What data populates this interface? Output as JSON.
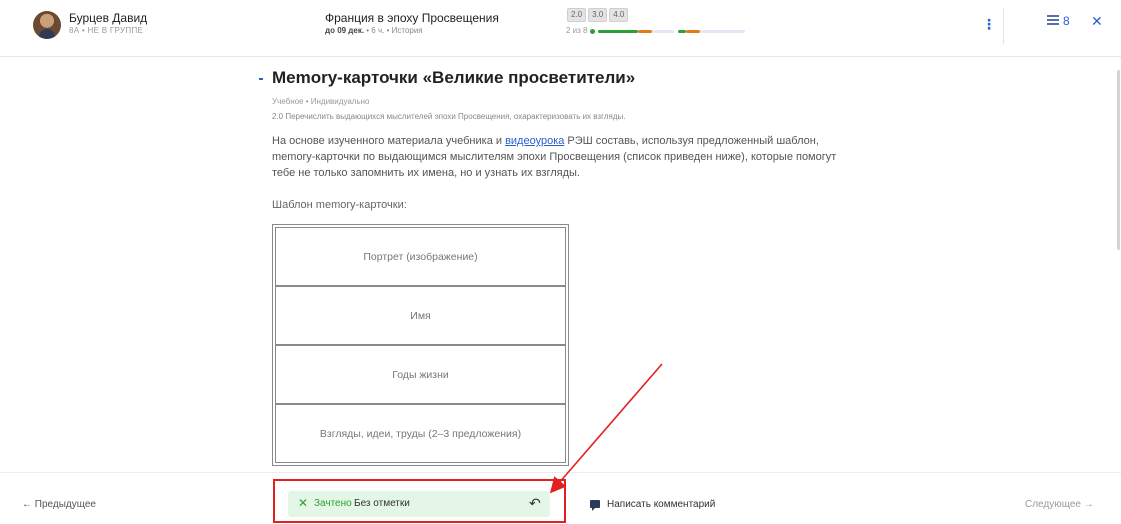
{
  "header": {
    "student_name": "Бурцев Давид",
    "student_group": "8А • НЕ В ГРУППЕ",
    "lesson_title": "Франция в эпоху Просвещения",
    "lesson_deadline": "до 09 дек.",
    "lesson_meta_rest": " • 6 ч. • История",
    "badges": [
      "2.0",
      "3.0",
      "4.0"
    ],
    "progress_text": "2 из 8",
    "progress_fraction": 0.25,
    "kebab_icon": "⋮",
    "tasks_count": "8",
    "close_icon": "✕"
  },
  "task": {
    "title": "Memory-карточки «Великие просветители»",
    "type": "Учебное • Индивидуально",
    "goal": "2.0 Перечислить выдающихся мыслителей эпохи Просвещения, охарактеризовать их взгляды.",
    "body_before_link": "На основе изученного материала учебника и ",
    "body_link": "видеоурока",
    "body_after_link": " РЭШ составь, используя предложенный шаблон, memory-карточки по выдающимся мыслителям эпохи Просвещения (список приведен ниже), которые помогут тебе не только запомнить их имена, но и узнать их взгляды.",
    "template_label": "Шаблон memory-карточки:",
    "template_rows": [
      "Портрет (изображение)",
      "Имя",
      "Годы жизни",
      "Взгляды, идеи, труды (2–3 предложения)"
    ]
  },
  "footer": {
    "prev_label": "← Предыдущее",
    "grade_check_icon": "✕",
    "grade_status": "Зачтено",
    "grade_mark": "Без отметки",
    "undo_icon": "↶",
    "comment_label": "Написать комментарий",
    "next_label": "Следующее →"
  },
  "colors": {
    "accent": "#2a5fd0",
    "success": "#2e9e3a",
    "highlight_red": "#e32020"
  }
}
